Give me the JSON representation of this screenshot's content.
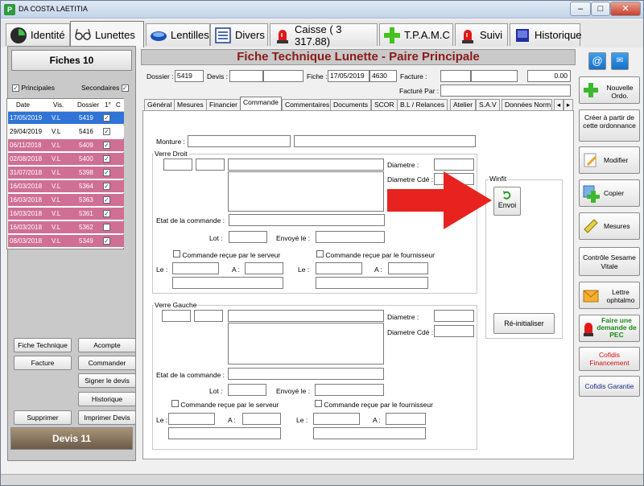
{
  "window": {
    "title": "DA COSTA LAETITIA",
    "minimize": "–",
    "maximize": "□",
    "close": "✕"
  },
  "main_tabs": [
    {
      "label": "Identité",
      "icon": "identity-circle-icon"
    },
    {
      "label": "Lunettes",
      "icon": "glasses-icon"
    },
    {
      "label": "Lentilles",
      "icon": "lens-icon"
    },
    {
      "label": "Divers",
      "icon": "list-icon"
    },
    {
      "label": "Caisse ( 3 317.88)",
      "icon": "siren-icon"
    },
    {
      "label": "T.P.A.M.C",
      "icon": "green-cross-icon"
    },
    {
      "label": "Suivi",
      "icon": "siren-icon"
    },
    {
      "label": "Historique",
      "icon": "book-icon"
    }
  ],
  "left": {
    "fiches_header": "Fiches 10",
    "principales": "Principales",
    "secondaires": "Secondaires",
    "columns": [
      "Date",
      "Vis.",
      "Dossier",
      "1°",
      "C"
    ],
    "rows": [
      {
        "date": "17/05/2019",
        "vis": "V.L",
        "dossier": "5419",
        "checked": true,
        "style": "selected"
      },
      {
        "date": "29/04/2019",
        "vis": "V.L",
        "dossier": "5416",
        "checked": true,
        "style": "white"
      },
      {
        "date": "06/11/2018",
        "vis": "V.L",
        "dossier": "5409",
        "checked": true,
        "style": "pink"
      },
      {
        "date": "02/08/2018",
        "vis": "V.L",
        "dossier": "5400",
        "checked": true,
        "style": "pink"
      },
      {
        "date": "31/07/2018",
        "vis": "V.L",
        "dossier": "5398",
        "checked": true,
        "style": "pink"
      },
      {
        "date": "16/03/2018",
        "vis": "V.L",
        "dossier": "5364",
        "checked": true,
        "style": "pink"
      },
      {
        "date": "16/03/2018",
        "vis": "V.L",
        "dossier": "5363",
        "checked": true,
        "style": "pink"
      },
      {
        "date": "16/03/2018",
        "vis": "V.L",
        "dossier": "5361",
        "checked": true,
        "style": "pink"
      },
      {
        "date": "16/03/2018",
        "vis": "V.L",
        "dossier": "5362",
        "checked": false,
        "style": "pink"
      },
      {
        "date": "08/03/2018",
        "vis": "V.L",
        "dossier": "5349",
        "checked": true,
        "style": "pink"
      }
    ],
    "buttons": {
      "fiche_technique": "Fiche Technique",
      "acompte": "Acompte",
      "facture": "Facture",
      "commander": "Commander",
      "signer_devis": "Signer le devis",
      "historique": "Historique",
      "supprimer": "Supprimer",
      "imprimer_devis": "Imprimer Devis"
    },
    "devis_header": "Devis 11"
  },
  "form": {
    "title": "Fiche Technique Lunette - Paire Principale",
    "dossier_label": "Dossier :",
    "dossier": "5419",
    "devis_label": "Devis :",
    "fiche_label": "Fiche :",
    "fiche_date": "17/05/2019",
    "fiche_num": "4630",
    "facture_label": "Facture :",
    "amount": "0.00",
    "facture_par_label": "Facturé Par :"
  },
  "sub_tabs": [
    "Général",
    "Mesures",
    "Financier",
    "Commande",
    "Commentaires",
    "Documents",
    "SCOR",
    "B.L / Relances",
    "Atelier",
    "S.A.V",
    "Données Norm"
  ],
  "commande": {
    "monture": "Monture :",
    "verre_droit": "Verre Droit",
    "verre_gauche": "Verre Gauche",
    "diametre": "Diametre :",
    "diametre_cde": "Diametre Cdé :",
    "etat": "Etat de la commande :",
    "lot": "Lot :",
    "envoye": "Envoyé le :",
    "recue_serveur": "Commande reçue par le serveur",
    "recue_fournisseur": "Commande reçue par le fournisseur",
    "le": "Le :",
    "a": "A :",
    "winfit": "Winfit",
    "envoi": "Envoi",
    "reinit": "Ré-initialiser"
  },
  "right_buttons": {
    "nouvelle_ordo": "Nouvelle Ordo.",
    "creer": "Créer à partir de cette ordonnance",
    "modifier": "Modifier",
    "copier": "Copier",
    "mesures": "Mesures",
    "controle": "Contrôle Sesame Vitale",
    "lettre": "Lettre ophtalmo",
    "faire_pec": "Faire une demande de PEC",
    "cofidis_fin": "Cofidis Financement",
    "cofidis_gar": "Cofidis Garantie"
  },
  "colors": {
    "pink": "#cf6f93",
    "selected": "#2f74d6",
    "red": "#8b1a1a",
    "arrow": "#e8231f"
  }
}
